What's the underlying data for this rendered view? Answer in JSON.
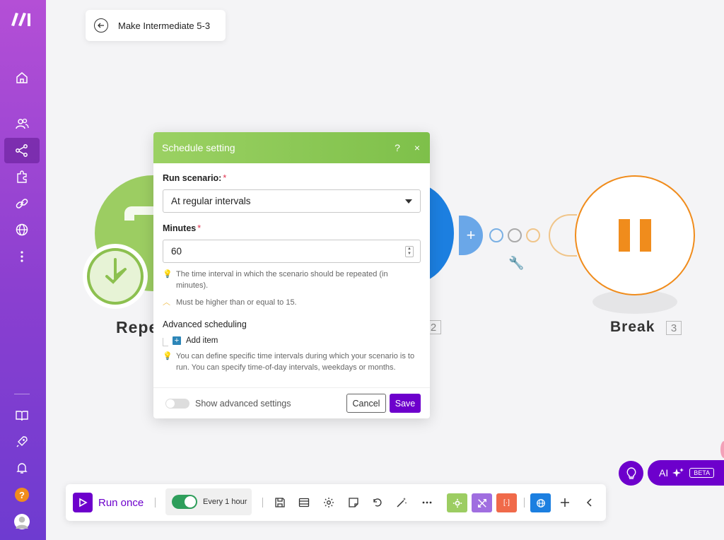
{
  "scenario": {
    "title": "Make Intermediate 5-3"
  },
  "canvas": {
    "node1": {
      "label": "Repe"
    },
    "node2": {
      "badge": "2"
    },
    "node3": {
      "label": "Break",
      "badge": "3"
    }
  },
  "modal": {
    "title": "Schedule setting",
    "help_label": "?",
    "close_label": "×",
    "run_scenario": {
      "label": "Run scenario:",
      "required": "*",
      "value": "At regular intervals"
    },
    "minutes": {
      "label": "Minutes",
      "required": "*",
      "value": "60",
      "hint": "The time interval in which the scenario should be repeated (in minutes).",
      "validation": "Must be higher than or equal to 15."
    },
    "advanced": {
      "title": "Advanced scheduling",
      "add_item": "Add item",
      "hint": "You can define specific time intervals during which your scenario is to run. You can specify time-of-day intervals, weekdays or months."
    },
    "footer": {
      "advanced_toggle_label": "Show advanced settings",
      "cancel": "Cancel",
      "save": "Save"
    }
  },
  "toolbar": {
    "run_once": "Run once",
    "schedule_label": "Every 1 hour",
    "schedule_enabled": true
  },
  "ai": {
    "label": "AI",
    "beta": "BETA"
  },
  "colors": {
    "accent": "#6d00cc",
    "green_header": "#8cc84f",
    "sidebar_top": "#b44fd6",
    "sidebar_bottom": "#6e3bd0",
    "break_orange": "#f08c1c"
  }
}
